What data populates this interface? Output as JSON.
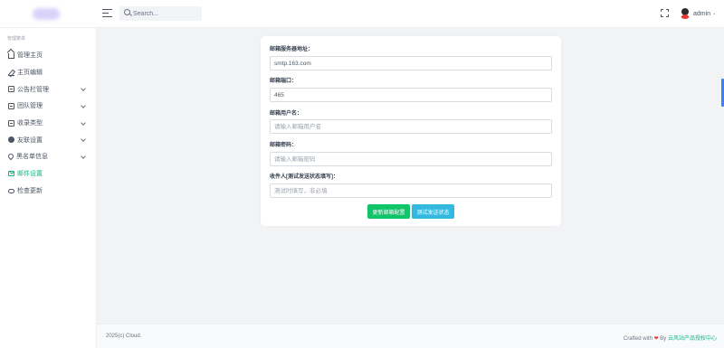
{
  "header": {
    "search_placeholder": "Search...",
    "user_name": "admin",
    "user_caret": "⌄"
  },
  "sidebar": {
    "title": "管理菜单",
    "items": [
      {
        "label": "管理主页",
        "icon": "home-icon",
        "has_submenu": false,
        "active": false
      },
      {
        "label": "主页编辑",
        "icon": "edit-icon",
        "has_submenu": false,
        "active": false
      },
      {
        "label": "公告栏管理",
        "icon": "notice-icon",
        "has_submenu": true,
        "active": false
      },
      {
        "label": "团队管理",
        "icon": "team-icon",
        "has_submenu": true,
        "active": false
      },
      {
        "label": "收录类型",
        "icon": "category-icon",
        "has_submenu": true,
        "active": false
      },
      {
        "label": "友联设置",
        "icon": "link-icon",
        "has_submenu": true,
        "active": false
      },
      {
        "label": "黑名单信息",
        "icon": "location-icon",
        "has_submenu": true,
        "active": false
      },
      {
        "label": "邮件设置",
        "icon": "mail-icon",
        "has_submenu": false,
        "active": true
      },
      {
        "label": "检查更新",
        "icon": "cloud-icon",
        "has_submenu": false,
        "active": false
      }
    ]
  },
  "form": {
    "smtp_label": "邮箱服务器地址：",
    "smtp_value": "smtp.163.com",
    "port_label": "邮箱端口：",
    "port_value": "465",
    "username_label": "邮箱用户名：",
    "username_placeholder": "请输入邮箱用户名",
    "password_label": "邮箱密码：",
    "password_placeholder": "请输入邮箱密码",
    "recipient_label": "收件人[测试发送状态填写]：",
    "recipient_placeholder": "测试时填写，非必填",
    "save_button": "更新邮箱配置",
    "test_button": "测试发送状态"
  },
  "footer": {
    "copyright": "2025(c) Cloud.",
    "crafted_prefix": "Crafted with",
    "heart": "❤",
    "by": "By",
    "link_text": "云风站产品授权中心"
  },
  "colors": {
    "accent": "#10b981",
    "save_button": "#10c469",
    "test_button": "#35b8e0"
  }
}
